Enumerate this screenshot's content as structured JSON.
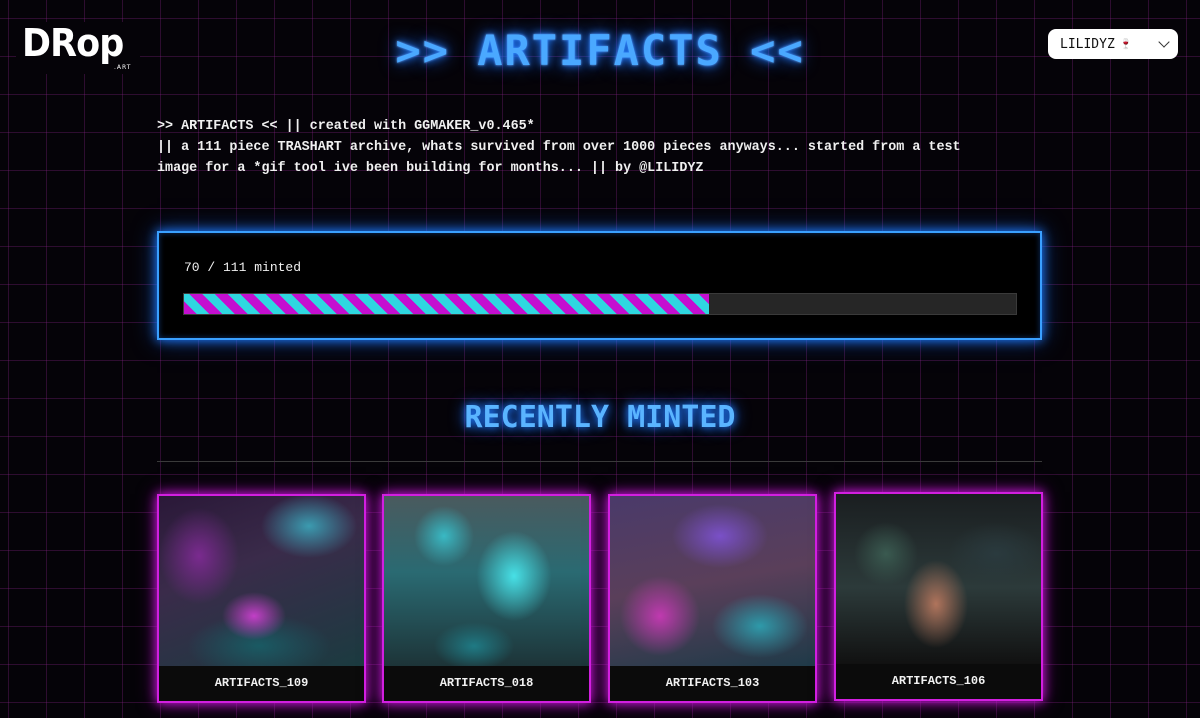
{
  "brand": {
    "logo_text": "DRop",
    "logo_sub": ".ART"
  },
  "header": {
    "title": ">> ARTIFACTS <<"
  },
  "user_menu": {
    "name": "LILIDYZ",
    "emoji": "🍷"
  },
  "description": {
    "lines": [
      ">> ARTIFACTS << || created with GGMAKER_v0.465*",
      "|| a 111 piece TRASHART archive, whats survived from over 1000 pieces anyways... started from a test",
      "image for a *gif tool ive been building for months... || by @LILIDYZ"
    ]
  },
  "mint_progress": {
    "label": "70 / 111 minted",
    "minted": 70,
    "total": 111
  },
  "recently_minted": {
    "title": "RECENTLY MINTED",
    "items": [
      {
        "name": "ARTIFACTS_109"
      },
      {
        "name": "ARTIFACTS_018"
      },
      {
        "name": "ARTIFACTS_103"
      },
      {
        "name": "ARTIFACTS_106"
      }
    ]
  },
  "colors": {
    "accent_blue": "#4aa8ff",
    "accent_magenta": "#d21fe0",
    "progress_stripe_a": "#c40fd0",
    "progress_stripe_b": "#2fd7e0"
  }
}
